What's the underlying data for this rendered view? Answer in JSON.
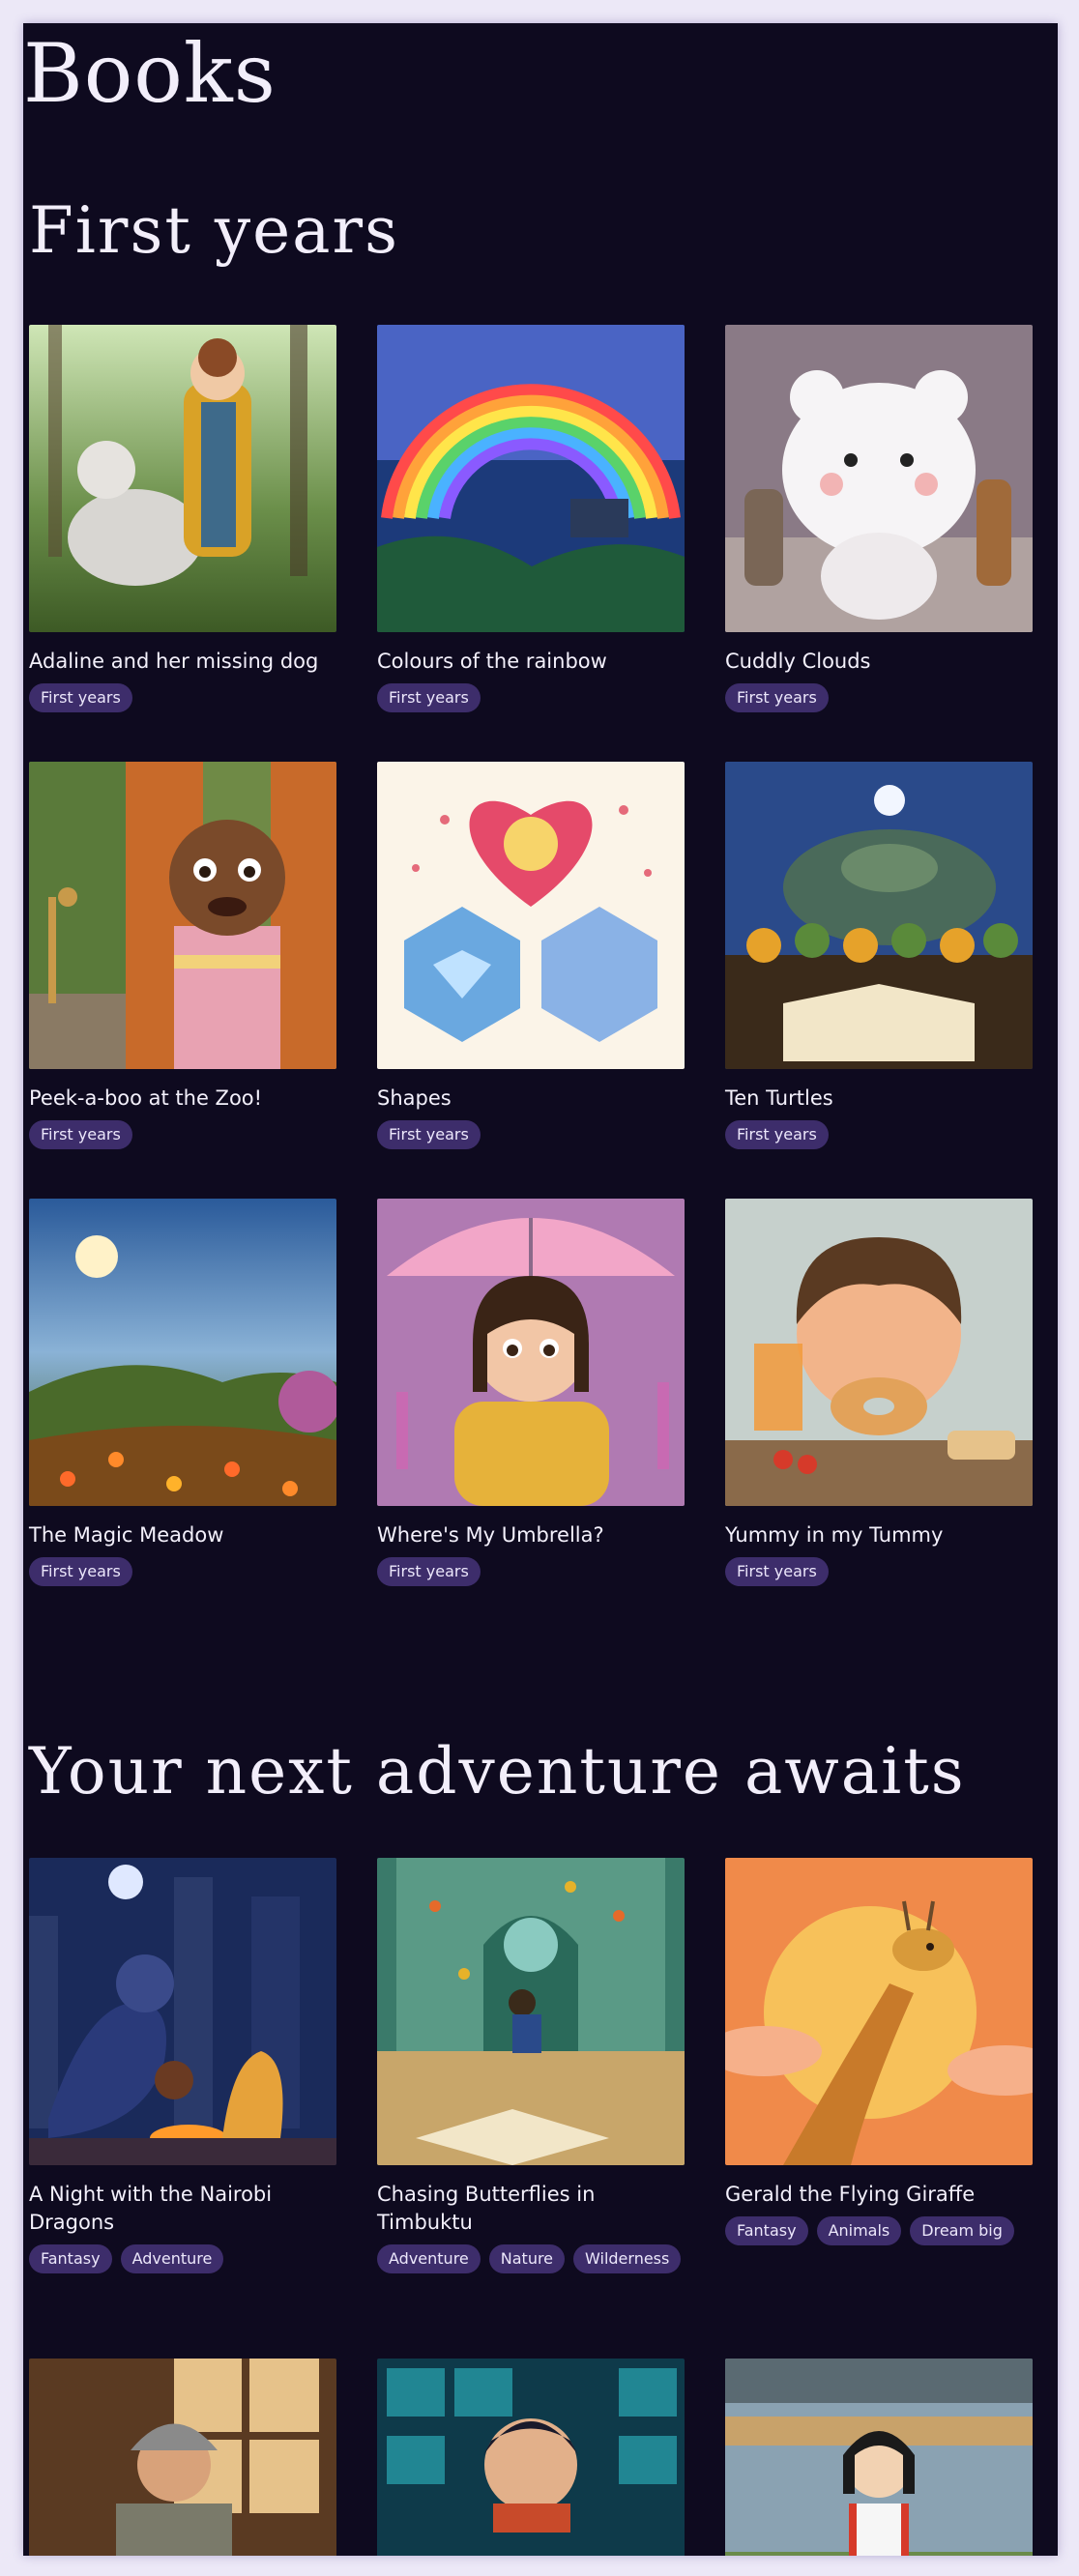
{
  "page": {
    "title": "Books"
  },
  "sections": [
    {
      "title": "First years",
      "books": [
        {
          "title": "Adaline and her missing dog",
          "tags": [
            "First years"
          ],
          "image": "girl-with-dog-illustration"
        },
        {
          "title": "Colours of the rainbow",
          "tags": [
            "First years"
          ],
          "image": "rainbow-landscape-illustration"
        },
        {
          "title": "Cuddly Clouds",
          "tags": [
            "First years"
          ],
          "image": "cloud-bear-illustration"
        },
        {
          "title": "Peek-a-boo at the Zoo!",
          "tags": [
            "First years"
          ],
          "image": "child-peeking-curtains-illustration"
        },
        {
          "title": "Shapes",
          "tags": [
            "First years"
          ],
          "image": "heart-and-hexagon-shapes-illustration"
        },
        {
          "title": "Ten Turtles",
          "tags": [
            "First years"
          ],
          "image": "turtles-with-book-illustration"
        },
        {
          "title": "The Magic Meadow",
          "tags": [
            "First years"
          ],
          "image": "meadow-sunset-illustration"
        },
        {
          "title": "Where's My Umbrella?",
          "tags": [
            "First years"
          ],
          "image": "girl-with-umbrella-illustration"
        },
        {
          "title": "Yummy in my Tummy",
          "tags": [
            "First years"
          ],
          "image": "boy-eating-donut-illustration"
        }
      ]
    },
    {
      "title": "Your next adventure awaits",
      "books": [
        {
          "title": "A Night with the Nairobi Dragons",
          "tags": [
            "Fantasy",
            "Adventure"
          ],
          "image": "dragons-city-night-illustration"
        },
        {
          "title": "Chasing Butterflies in Timbuktu",
          "tags": [
            "Adventure",
            "Nature",
            "Wilderness"
          ],
          "image": "boy-chasing-butterflies-illustration"
        },
        {
          "title": "Gerald the Flying Giraffe",
          "tags": [
            "Fantasy",
            "Animals",
            "Dream big"
          ],
          "image": "giraffe-sunset-illustration"
        },
        {
          "title": "",
          "tags": [],
          "image": "old-man-workshop-illustration"
        },
        {
          "title": "",
          "tags": [],
          "image": "boy-periodic-table-illustration"
        },
        {
          "title": "",
          "tags": [],
          "image": "girl-at-market-illustration"
        }
      ]
    }
  ]
}
